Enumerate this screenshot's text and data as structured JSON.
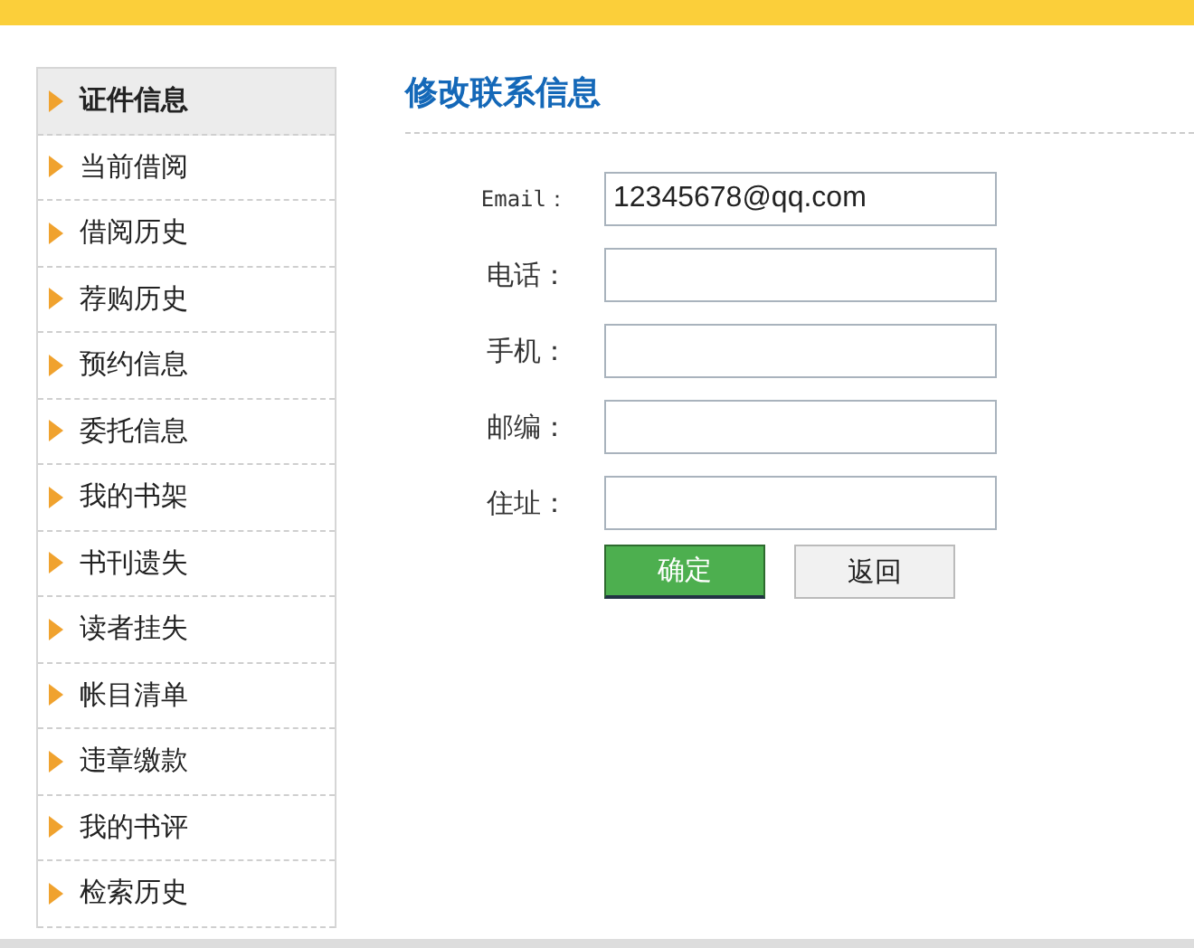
{
  "sidebar": {
    "items": [
      {
        "label": "证件信息",
        "selected": true
      },
      {
        "label": "当前借阅",
        "selected": false
      },
      {
        "label": "借阅历史",
        "selected": false
      },
      {
        "label": "荐购历史",
        "selected": false
      },
      {
        "label": "预约信息",
        "selected": false
      },
      {
        "label": "委托信息",
        "selected": false
      },
      {
        "label": "我的书架",
        "selected": false
      },
      {
        "label": "书刊遗失",
        "selected": false
      },
      {
        "label": "读者挂失",
        "selected": false
      },
      {
        "label": "帐目清单",
        "selected": false
      },
      {
        "label": "违章缴款",
        "selected": false
      },
      {
        "label": "我的书评",
        "selected": false
      },
      {
        "label": "检索历史",
        "selected": false
      }
    ]
  },
  "form": {
    "title": "修改联系信息",
    "fields": [
      {
        "label": "Email：",
        "value": "12345678@qq.com"
      },
      {
        "label": "电话："
      },
      {
        "label": "手机："
      },
      {
        "label": "邮编："
      },
      {
        "label": "住址："
      }
    ],
    "buttons": [
      {
        "label": "确定",
        "kind": "primary"
      },
      {
        "label": "返回",
        "kind": "secondary"
      }
    ]
  }
}
